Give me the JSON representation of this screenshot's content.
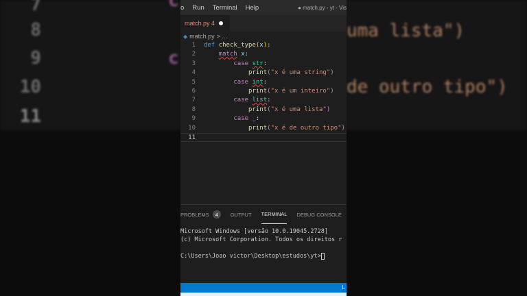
{
  "background": {
    "line_numbers": [
      "7",
      "8",
      "9",
      "10",
      "11"
    ],
    "fragments": [
      "c",
      "c",
      "uma lista\")",
      "de outro tipo\")"
    ]
  },
  "menu": {
    "items": [
      "o",
      "Run",
      "Terminal",
      "Help"
    ],
    "window_title": "● match.py - yt - Vis"
  },
  "tab": {
    "label": "match.py 4"
  },
  "breadcrumb": {
    "file": "match.py",
    "rest": "> ..."
  },
  "code": {
    "line_numbers": [
      "1",
      "2",
      "3",
      "4",
      "5",
      "6",
      "7",
      "8",
      "9",
      "10",
      "11"
    ],
    "lines": [
      "def check_type(x):",
      "    match x:",
      "        case str:",
      "            print(\"x é uma string\")",
      "        case int:",
      "            print(\"x é um inteiro\")",
      "        case list:",
      "            print(\"x é uma lista\")",
      "        case _:",
      "            print(\"x é de outro tipo\")",
      ""
    ]
  },
  "panel": {
    "tabs": [
      "PROBLEMS",
      "OUTPUT",
      "TERMINAL",
      "DEBUG CONSOLE"
    ],
    "problems_count": "4",
    "terminal": [
      "Microsoft Windows [versão 10.0.19045.2728]",
      "(c) Microsoft Corporation. Todos os direitos r",
      "",
      "C:\\Users\\Joao victor\\Desktop\\estudos\\yt>"
    ]
  },
  "status": {
    "right": "L"
  }
}
